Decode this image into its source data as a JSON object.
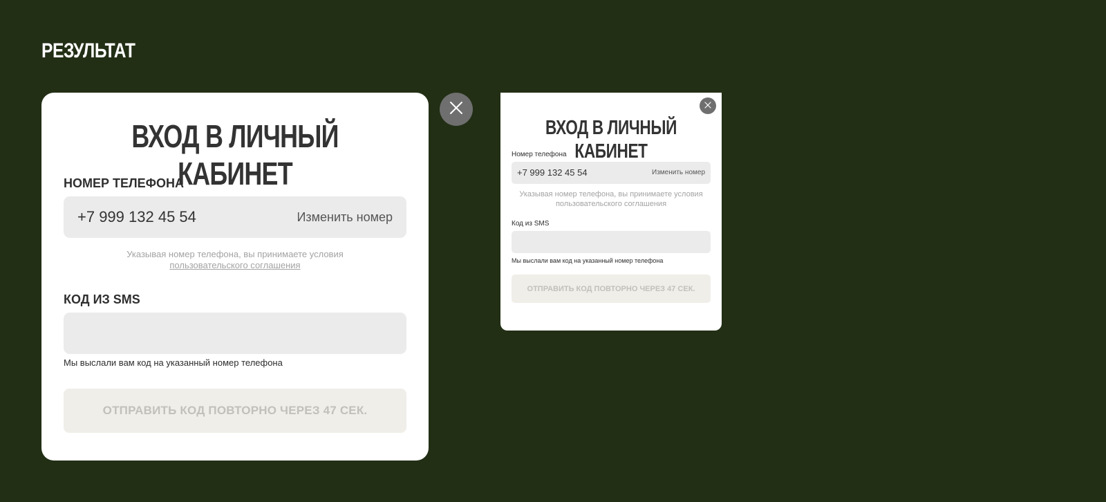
{
  "page": {
    "section_title": "РЕЗУЛЬТАТ",
    "background_color": "#222f15"
  },
  "large_modal": {
    "title": "ВХОД В ЛИЧНЫЙ КАБИНЕТ",
    "phone_label": "НОМЕР ТЕЛЕФОНА",
    "phone_value": "+7 999 132 45 54",
    "change_number": "Изменить номер",
    "consent_text": "Указывая номер телефона, вы принимаете условия",
    "consent_link": "пользовательского соглашения",
    "sms_label": "КОД ИЗ SMS",
    "sms_value": "",
    "sms_hint": "Мы выслали вам код на указанный номер телефона",
    "resend_button": "ОТПРАВИТЬ КОД ПОВТОРНО ЧЕРЕЗ 47 СЕК.",
    "close_icon": "close-icon"
  },
  "small_modal": {
    "title": "ВХОД В ЛИЧНЫЙ КАБИНЕТ",
    "phone_label": "Номер телефона",
    "phone_value": "+7 999 132 45 54",
    "change_number": "Изменить номер",
    "consent_text": "Указывая номер телефона, вы принимаете условия",
    "consent_link": "пользовательского соглашения",
    "sms_label": "Код из SMS",
    "sms_value": "",
    "sms_hint": "Мы выслали вам код на указанный номер телефона",
    "resend_button": "ОТПРАВИТЬ КОД ПОВТОРНО ЧЕРЕЗ 47 СЕК.",
    "close_icon": "close-icon"
  },
  "colors": {
    "modal_bg": "#ffffff",
    "input_bg": "#ebebeb",
    "button_disabled_bg": "#f0eee8",
    "button_disabled_text": "#c2c0bb",
    "close_button_bg": "#6f6f6f",
    "hint_text": "#a3a3a3",
    "title_text": "#333333"
  }
}
